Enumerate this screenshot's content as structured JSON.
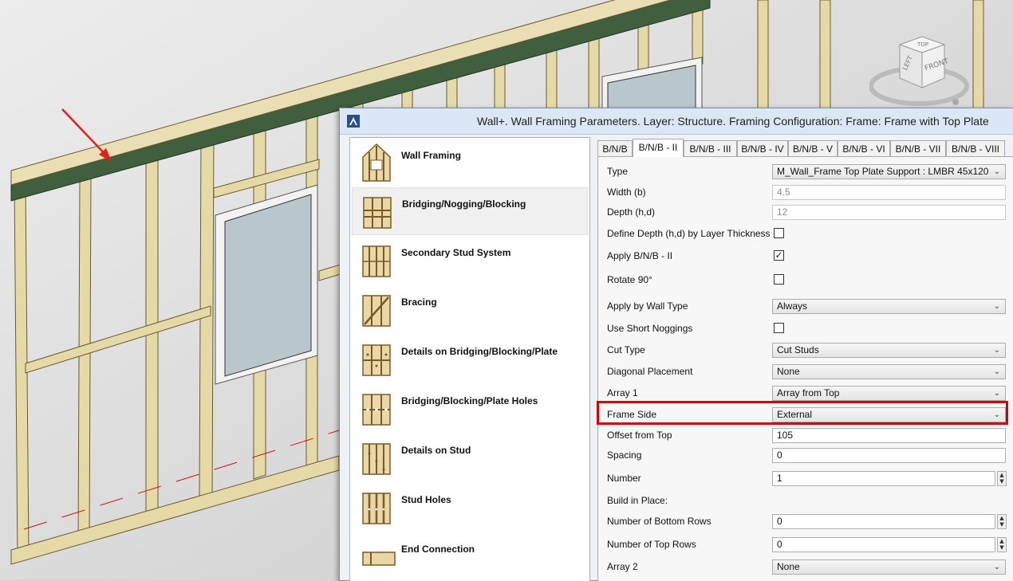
{
  "dialog": {
    "title": "Wall+. Wall Framing Parameters. Layer: Structure. Framing Configuration: Frame: Frame with Top Plate"
  },
  "viewcube": {
    "top": "TOP",
    "left": "LEFT",
    "front": "FRONT"
  },
  "nav": {
    "items": [
      {
        "label": "Wall Framing",
        "icon": "wall-framing-icon"
      },
      {
        "label": "Bridging/Nogging/Blocking",
        "icon": "bridging-icon"
      },
      {
        "label": "Secondary Stud System",
        "icon": "secondary-stud-icon"
      },
      {
        "label": "Bracing",
        "icon": "bracing-icon"
      },
      {
        "label": "Details on Bridging/Blocking/Plate",
        "icon": "details-bridging-icon"
      },
      {
        "label": "Bridging/Blocking/Plate Holes",
        "icon": "plate-holes-icon"
      },
      {
        "label": "Details on Stud",
        "icon": "details-stud-icon"
      },
      {
        "label": "Stud Holes",
        "icon": "stud-holes-icon"
      },
      {
        "label": "End Connection",
        "icon": "end-connection-icon"
      }
    ],
    "selected": "Bridging/Nogging/Blocking"
  },
  "tabs": [
    "B/N/B",
    "B/N/B - II",
    "B/N/B - III",
    "B/N/B - IV",
    "B/N/B - V",
    "B/N/B - VI",
    "B/N/B - VII",
    "B/N/B - VIII"
  ],
  "active_tab": "B/N/B - II",
  "properties": {
    "type": {
      "label": "Type",
      "value": "M_Wall_Frame Top Plate Support : LMBR 45x120"
    },
    "width": {
      "label": "Width (b)",
      "value": "4.5"
    },
    "depth": {
      "label": "Depth (h,d)",
      "value": "12"
    },
    "define_depth": {
      "label": "Define Depth (h,d) by Layer Thickness",
      "checked": false,
      "mark": ""
    },
    "apply": {
      "label": "Apply B/N/B - II",
      "checked": true,
      "mark": "✓"
    },
    "rotate": {
      "label": "Rotate 90°",
      "checked": false,
      "mark": ""
    },
    "apply_by_wall_type": {
      "label": "Apply by Wall Type",
      "value": "Always"
    },
    "use_short_noggings": {
      "label": "Use Short Noggings",
      "checked": false,
      "mark": ""
    },
    "cut_type": {
      "label": "Cut Type",
      "value": "Cut Studs"
    },
    "diagonal_placement": {
      "label": "Diagonal Placement",
      "value": "None"
    },
    "array1": {
      "label": "Array 1",
      "value": "Array from Top"
    },
    "frame_side": {
      "label": "Frame Side",
      "value": "External"
    },
    "offset_from_top": {
      "label": "Offset from Top",
      "value": "105"
    },
    "spacing": {
      "label": "Spacing",
      "value": "0"
    },
    "number": {
      "label": "Number",
      "value": "1"
    },
    "build_in_place": {
      "label": "Build in Place:"
    },
    "bottom_rows": {
      "label": "Number of Bottom Rows",
      "value": "0"
    },
    "top_rows": {
      "label": "Number of Top Rows",
      "value": "0"
    },
    "array2": {
      "label": "Array 2",
      "value": "None"
    }
  },
  "colors": {
    "highlight": "#d00000",
    "arrow": "#e02020",
    "timber": "#e8dcae",
    "top_plate": "#3a5a3a"
  }
}
